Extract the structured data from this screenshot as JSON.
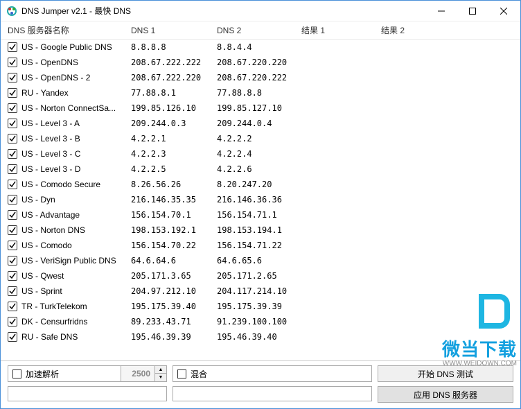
{
  "window": {
    "title": "DNS Jumper v2.1 - 最快 DNS"
  },
  "columns": {
    "name": "DNS 服务器名称",
    "dns1": "DNS 1",
    "dns2": "DNS 2",
    "r1": "结果 1",
    "r2": "结果 2"
  },
  "rows": [
    {
      "checked": true,
      "name": "US - Google Public DNS",
      "dns1": "8.8.8.8",
      "dns2": "8.8.4.4"
    },
    {
      "checked": true,
      "name": "US - OpenDNS",
      "dns1": "208.67.222.222",
      "dns2": "208.67.220.220"
    },
    {
      "checked": true,
      "name": "US - OpenDNS - 2",
      "dns1": "208.67.222.220",
      "dns2": "208.67.220.222"
    },
    {
      "checked": true,
      "name": "RU - Yandex",
      "dns1": "77.88.8.1",
      "dns2": "77.88.8.8"
    },
    {
      "checked": true,
      "name": "US - Norton ConnectSa...",
      "dns1": "199.85.126.10",
      "dns2": "199.85.127.10"
    },
    {
      "checked": true,
      "name": "US - Level 3 - A",
      "dns1": "209.244.0.3",
      "dns2": "209.244.0.4"
    },
    {
      "checked": true,
      "name": "US - Level 3 - B",
      "dns1": "4.2.2.1",
      "dns2": "4.2.2.2"
    },
    {
      "checked": true,
      "name": "US - Level 3 - C",
      "dns1": "4.2.2.3",
      "dns2": "4.2.2.4"
    },
    {
      "checked": true,
      "name": "US - Level 3 - D",
      "dns1": "4.2.2.5",
      "dns2": "4.2.2.6"
    },
    {
      "checked": true,
      "name": "US - Comodo Secure",
      "dns1": "8.26.56.26",
      "dns2": "8.20.247.20"
    },
    {
      "checked": true,
      "name": "US - Dyn",
      "dns1": "216.146.35.35",
      "dns2": "216.146.36.36"
    },
    {
      "checked": true,
      "name": "US - Advantage",
      "dns1": "156.154.70.1",
      "dns2": "156.154.71.1"
    },
    {
      "checked": true,
      "name": "US - Norton DNS",
      "dns1": "198.153.192.1",
      "dns2": "198.153.194.1"
    },
    {
      "checked": true,
      "name": "US - Comodo",
      "dns1": "156.154.70.22",
      "dns2": "156.154.71.22"
    },
    {
      "checked": true,
      "name": "US - VeriSign Public DNS",
      "dns1": "64.6.64.6",
      "dns2": "64.6.65.6"
    },
    {
      "checked": true,
      "name": "US - Qwest",
      "dns1": "205.171.3.65",
      "dns2": "205.171.2.65"
    },
    {
      "checked": true,
      "name": "US - Sprint",
      "dns1": "204.97.212.10",
      "dns2": "204.117.214.10"
    },
    {
      "checked": true,
      "name": "TR - TurkTelekom",
      "dns1": "195.175.39.40",
      "dns2": "195.175.39.39"
    },
    {
      "checked": true,
      "name": "DK - Censurfridns",
      "dns1": "89.233.43.71",
      "dns2": "91.239.100.100"
    },
    {
      "checked": true,
      "name": "RU - Safe DNS",
      "dns1": "195.46.39.39",
      "dns2": "195.46.39.40"
    }
  ],
  "bottom": {
    "accel_label": "加速解析",
    "spin_value": "2500",
    "mix_label": "混合",
    "start_btn": "开始 DNS 测试",
    "apply_btn": "应用 DNS 服务器"
  },
  "watermark": {
    "text": "微当下载",
    "url": "WWW.WEIDOWN.COM"
  }
}
